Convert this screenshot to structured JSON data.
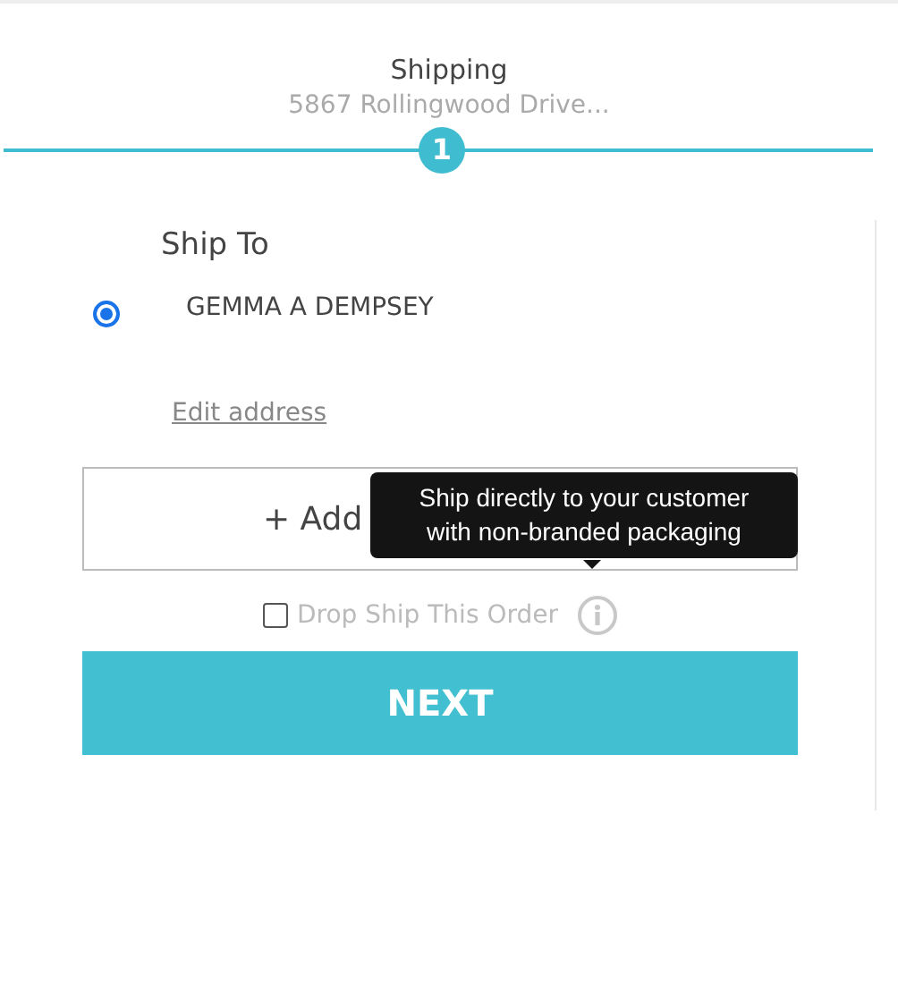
{
  "step": {
    "title": "Shipping",
    "subtitle": "5867 Rollingwood Drive...",
    "number": "1"
  },
  "ship_to": {
    "heading": "Ship To",
    "addresses": [
      {
        "name": "GEMMA A DEMPSEY",
        "selected": true
      }
    ],
    "edit_link": "Edit address"
  },
  "add_button": "+ Add",
  "drop_ship": {
    "label": "Drop Ship This Order",
    "checked": false,
    "tooltip": "Ship directly to your customer with non-branded packaging"
  },
  "next_button": "NEXT"
}
